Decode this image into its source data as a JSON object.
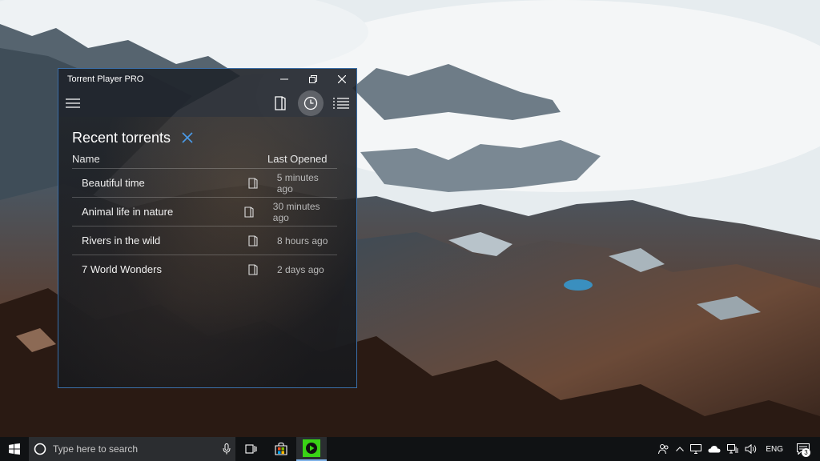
{
  "window": {
    "title": "Torrent Player PRO",
    "controls": {
      "minimize": "minimize-icon",
      "restore": "restore-icon",
      "close": "close-icon"
    },
    "accent": "#3b6fa8"
  },
  "toolbar": {
    "menu_icon": "hamburger-icon",
    "buttons": [
      {
        "name": "open-file",
        "icon": "book-open-icon",
        "active": false
      },
      {
        "name": "recent",
        "icon": "clock-icon",
        "active": true
      },
      {
        "name": "list",
        "icon": "list-icon",
        "active": false
      }
    ]
  },
  "recent": {
    "title": "Recent torrents",
    "close_color": "#4a9be8",
    "columns": {
      "name": "Name",
      "last_opened": "Last Opened"
    },
    "items": [
      {
        "name": "Beautiful time",
        "last_opened": "5 minutes ago"
      },
      {
        "name": "Animal life in nature",
        "last_opened": "30  minutes ago"
      },
      {
        "name": "Rivers in the wild",
        "last_opened": "8 hours ago"
      },
      {
        "name": "7 World Wonders",
        "last_opened": "2 days ago"
      }
    ]
  },
  "taskbar": {
    "search_placeholder": "Type here to search",
    "language": "ENG",
    "notification_count": "3",
    "pinned": [
      {
        "name": "task-view",
        "icon": "task-view-icon"
      },
      {
        "name": "store",
        "icon": "store-icon"
      },
      {
        "name": "torrent-player",
        "icon": "torrent-player-icon",
        "active": true
      }
    ],
    "app_icon_color": "#39d315"
  }
}
